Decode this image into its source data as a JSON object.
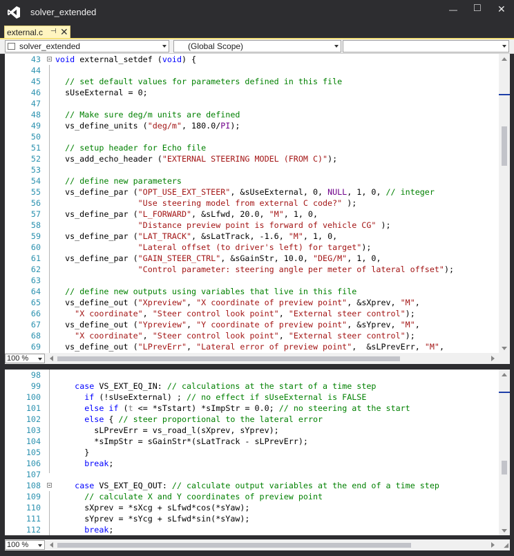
{
  "window": {
    "title": "solver_extended",
    "minimize_glyph": "—",
    "maximize_glyph": "□",
    "close_glyph": "✕"
  },
  "tab": {
    "label": "external.c",
    "pin_glyph": "⊣",
    "close_glyph": "✕"
  },
  "navbar": {
    "project": "solver_extended",
    "scope": "(Global Scope)",
    "member": ""
  },
  "top_pane": {
    "zoom": "100 %",
    "lines": [
      {
        "n": "43",
        "fold": true,
        "t": [
          [
            "k",
            "void"
          ],
          [
            "p",
            " external_setdef ("
          ],
          [
            "k",
            "void"
          ],
          [
            "p",
            ") {"
          ]
        ]
      },
      {
        "n": "44",
        "t": []
      },
      {
        "n": "45",
        "t": [
          [
            "p",
            "  "
          ],
          [
            "c",
            "// set default values for parameters defined in this file"
          ]
        ]
      },
      {
        "n": "46",
        "t": [
          [
            "p",
            "  sUseExternal = 0;"
          ]
        ]
      },
      {
        "n": "47",
        "t": []
      },
      {
        "n": "48",
        "t": [
          [
            "p",
            "  "
          ],
          [
            "c",
            "// Make sure deg/m units are defined"
          ]
        ]
      },
      {
        "n": "49",
        "t": [
          [
            "p",
            "  vs_define_units ("
          ],
          [
            "s",
            "\"deg/m\""
          ],
          [
            "p",
            ", 180.0/"
          ],
          [
            "m",
            "PI"
          ],
          [
            "p",
            ");"
          ]
        ]
      },
      {
        "n": "50",
        "t": []
      },
      {
        "n": "51",
        "t": [
          [
            "p",
            "  "
          ],
          [
            "c",
            "// setup header for Echo file"
          ]
        ]
      },
      {
        "n": "52",
        "t": [
          [
            "p",
            "  vs_add_echo_header ("
          ],
          [
            "s",
            "\"EXTERNAL STEERING MODEL (FROM C)\""
          ],
          [
            "p",
            ");"
          ]
        ]
      },
      {
        "n": "53",
        "t": []
      },
      {
        "n": "54",
        "t": [
          [
            "p",
            "  "
          ],
          [
            "c",
            "// define new parameters"
          ]
        ]
      },
      {
        "n": "55",
        "t": [
          [
            "p",
            "  vs_define_par ("
          ],
          [
            "s",
            "\"OPT_USE_EXT_STEER\""
          ],
          [
            "p",
            ", &sUseExternal, 0, "
          ],
          [
            "m",
            "NULL"
          ],
          [
            "p",
            ", 1, 0, "
          ],
          [
            "c",
            "// integer"
          ]
        ]
      },
      {
        "n": "56",
        "t": [
          [
            "p",
            "                 "
          ],
          [
            "s",
            "\"Use steering model from external C code?\""
          ],
          [
            "p",
            " );"
          ]
        ]
      },
      {
        "n": "57",
        "t": [
          [
            "p",
            "  vs_define_par ("
          ],
          [
            "s",
            "\"L_FORWARD\""
          ],
          [
            "p",
            ", &sLfwd, 20.0, "
          ],
          [
            "s",
            "\"M\""
          ],
          [
            "p",
            ", 1, 0,"
          ]
        ]
      },
      {
        "n": "58",
        "t": [
          [
            "p",
            "                 "
          ],
          [
            "s",
            "\"Distance preview point is forward of vehicle CG\""
          ],
          [
            "p",
            " );"
          ]
        ]
      },
      {
        "n": "59",
        "t": [
          [
            "p",
            "  vs_define_par ("
          ],
          [
            "s",
            "\"LAT_TRACK\""
          ],
          [
            "p",
            ", &sLatTrack, -1.6, "
          ],
          [
            "s",
            "\"M\""
          ],
          [
            "p",
            ", 1, 0,"
          ]
        ]
      },
      {
        "n": "60",
        "t": [
          [
            "p",
            "                 "
          ],
          [
            "s",
            "\"Lateral offset (to driver's left) for target\""
          ],
          [
            "p",
            ");"
          ]
        ]
      },
      {
        "n": "61",
        "t": [
          [
            "p",
            "  vs_define_par ("
          ],
          [
            "s",
            "\"GAIN_STEER_CTRL\""
          ],
          [
            "p",
            ", &sGainStr, 10.0, "
          ],
          [
            "s",
            "\"DEG/M\""
          ],
          [
            "p",
            ", 1, 0,"
          ]
        ]
      },
      {
        "n": "62",
        "t": [
          [
            "p",
            "                 "
          ],
          [
            "s",
            "\"Control parameter: steering angle per meter of lateral offset\""
          ],
          [
            "p",
            ");"
          ]
        ]
      },
      {
        "n": "63",
        "t": []
      },
      {
        "n": "64",
        "t": [
          [
            "p",
            "  "
          ],
          [
            "c",
            "// define new outputs using variables that live in this file"
          ]
        ]
      },
      {
        "n": "65",
        "t": [
          [
            "p",
            "  vs_define_out ("
          ],
          [
            "s",
            "\"Xpreview\""
          ],
          [
            "p",
            ", "
          ],
          [
            "s",
            "\"X coordinate of preview point\""
          ],
          [
            "p",
            ", &sXprev, "
          ],
          [
            "s",
            "\"M\""
          ],
          [
            "p",
            ","
          ]
        ]
      },
      {
        "n": "66",
        "t": [
          [
            "p",
            "    "
          ],
          [
            "s",
            "\"X coordinate\""
          ],
          [
            "p",
            ", "
          ],
          [
            "s",
            "\"Steer control look point\""
          ],
          [
            "p",
            ", "
          ],
          [
            "s",
            "\"External steer control\""
          ],
          [
            "p",
            ");"
          ]
        ]
      },
      {
        "n": "67",
        "t": [
          [
            "p",
            "  vs_define_out ("
          ],
          [
            "s",
            "\"Ypreview\""
          ],
          [
            "p",
            ", "
          ],
          [
            "s",
            "\"Y coordinate of preview point\""
          ],
          [
            "p",
            ", &sYprev, "
          ],
          [
            "s",
            "\"M\""
          ],
          [
            "p",
            ","
          ]
        ]
      },
      {
        "n": "68",
        "t": [
          [
            "p",
            "    "
          ],
          [
            "s",
            "\"X coordinate\""
          ],
          [
            "p",
            ", "
          ],
          [
            "s",
            "\"Steer control look point\""
          ],
          [
            "p",
            ", "
          ],
          [
            "s",
            "\"External steer control\""
          ],
          [
            "p",
            ");"
          ]
        ]
      },
      {
        "n": "69",
        "t": [
          [
            "p",
            "  vs_define_out ("
          ],
          [
            "s",
            "\"LPrevErr\""
          ],
          [
            "p",
            ", "
          ],
          [
            "s",
            "\"Lateral error of preview point\""
          ],
          [
            "p",
            ",  &sLPrevErr, "
          ],
          [
            "s",
            "\"M\""
          ],
          [
            "p",
            ","
          ]
        ]
      }
    ]
  },
  "bottom_pane": {
    "zoom": "100 %",
    "lines": [
      {
        "n": "98",
        "t": []
      },
      {
        "n": "99",
        "t": [
          [
            "p",
            "    "
          ],
          [
            "k",
            "case"
          ],
          [
            "p",
            " VS_EXT_EQ_IN: "
          ],
          [
            "c",
            "// calculations at the start of a time step"
          ]
        ]
      },
      {
        "n": "100",
        "t": [
          [
            "p",
            "      "
          ],
          [
            "k",
            "if"
          ],
          [
            "p",
            " (!sUseExternal) ; "
          ],
          [
            "c",
            "// no effect if sUseExternal is FALSE"
          ]
        ]
      },
      {
        "n": "101",
        "t": [
          [
            "p",
            "      "
          ],
          [
            "k",
            "else if"
          ],
          [
            "p",
            " ("
          ],
          [
            "g",
            "t"
          ],
          [
            "p",
            " <= *sTstart) *sImpStr = 0.0; "
          ],
          [
            "c",
            "// no steering at the start"
          ]
        ]
      },
      {
        "n": "102",
        "t": [
          [
            "p",
            "      "
          ],
          [
            "k",
            "else"
          ],
          [
            "p",
            " { "
          ],
          [
            "c",
            "// steer proportional to the lateral error"
          ]
        ]
      },
      {
        "n": "103",
        "t": [
          [
            "p",
            "        sLPrevErr = vs_road_l(sXprev, sYprev);"
          ]
        ]
      },
      {
        "n": "104",
        "t": [
          [
            "p",
            "        *sImpStr = sGainStr*(sLatTrack - sLPrevErr);"
          ]
        ]
      },
      {
        "n": "105",
        "t": [
          [
            "p",
            "      }"
          ]
        ]
      },
      {
        "n": "106",
        "t": [
          [
            "p",
            "      "
          ],
          [
            "k",
            "break"
          ],
          [
            "p",
            ";"
          ]
        ]
      },
      {
        "n": "107",
        "t": []
      },
      {
        "n": "108",
        "fold": true,
        "t": [
          [
            "p",
            "    "
          ],
          [
            "k",
            "case"
          ],
          [
            "p",
            " VS_EXT_EQ_OUT: "
          ],
          [
            "c",
            "// calculate output variables at the end of a time step"
          ]
        ]
      },
      {
        "n": "109",
        "t": [
          [
            "p",
            "      "
          ],
          [
            "c",
            "// calculate X and Y coordinates of preview point"
          ]
        ]
      },
      {
        "n": "110",
        "t": [
          [
            "p",
            "      sXprev = *sXcg + sLfwd*cos(*sYaw);"
          ]
        ]
      },
      {
        "n": "111",
        "t": [
          [
            "p",
            "      sYprev = *sYcg + sLfwd*sin(*sYaw);"
          ]
        ]
      },
      {
        "n": "112",
        "t": [
          [
            "p",
            "      "
          ],
          [
            "k",
            "break"
          ],
          [
            "p",
            ";"
          ]
        ]
      }
    ]
  },
  "colors": {
    "keyword": "#0000ff",
    "comment": "#008000",
    "string": "#a31515",
    "macro": "#6f008a",
    "gray": "#808080",
    "plain": "#000000",
    "line_number": "#2b91af",
    "tab_active": "#fff5c0",
    "chrome": "#2d2d30"
  }
}
